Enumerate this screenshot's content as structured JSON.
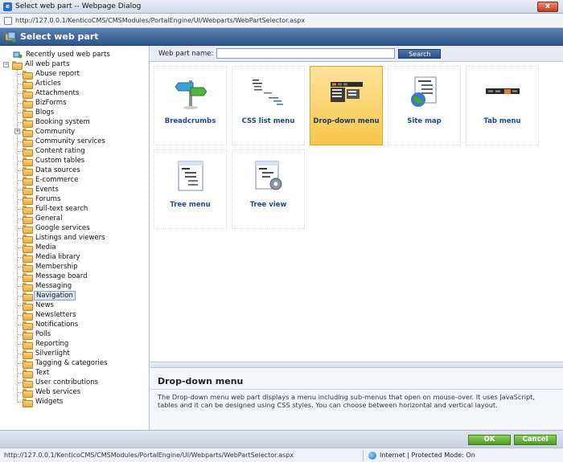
{
  "window": {
    "title": "Select web part -- Webpage Dialog",
    "close_label": "x",
    "url": "http://127.0.0.1/KenticoCMS/CMSModules/PortalEngine/UI/Webparts/WebPartSelector.aspx"
  },
  "header": {
    "title": "Select web part"
  },
  "tree": {
    "recent": "Recently used web parts",
    "root": "All web parts",
    "items": [
      {
        "label": "Abuse report"
      },
      {
        "label": "Articles"
      },
      {
        "label": "Attachments"
      },
      {
        "label": "BizForms"
      },
      {
        "label": "Blogs"
      },
      {
        "label": "Booking system"
      },
      {
        "label": "Community"
      },
      {
        "label": "Community services"
      },
      {
        "label": "Content rating"
      },
      {
        "label": "Custom tables"
      },
      {
        "label": "Data sources"
      },
      {
        "label": "E-commerce"
      },
      {
        "label": "Events"
      },
      {
        "label": "Forums"
      },
      {
        "label": "Full-text search"
      },
      {
        "label": "General"
      },
      {
        "label": "Google services"
      },
      {
        "label": "Listings and viewers"
      },
      {
        "label": "Media"
      },
      {
        "label": "Media library"
      },
      {
        "label": "Membership"
      },
      {
        "label": "Message board"
      },
      {
        "label": "Messaging"
      },
      {
        "label": "Navigation"
      },
      {
        "label": "News"
      },
      {
        "label": "Newsletters"
      },
      {
        "label": "Notifications"
      },
      {
        "label": "Polls"
      },
      {
        "label": "Reporting"
      },
      {
        "label": "Silverlight"
      },
      {
        "label": "Tagging & categories"
      },
      {
        "label": "Text"
      },
      {
        "label": "User contributions"
      },
      {
        "label": "Web services"
      },
      {
        "label": "Widgets"
      }
    ],
    "expandable_item": "Community",
    "selected_item": "Navigation"
  },
  "search": {
    "label": "Web part name:",
    "value": "",
    "button": "Search"
  },
  "webparts": [
    {
      "name": "Breadcrumbs",
      "icon": "signpost-icon"
    },
    {
      "name": "CSS list menu",
      "icon": "css-list-menu-icon"
    },
    {
      "name": "Drop-down menu",
      "icon": "dropdown-menu-icon",
      "selected": true
    },
    {
      "name": "Site map",
      "icon": "site-map-icon"
    },
    {
      "name": "Tab menu",
      "icon": "tab-menu-icon"
    },
    {
      "name": "Tree menu",
      "icon": "tree-menu-icon"
    },
    {
      "name": "Tree view",
      "icon": "tree-view-icon"
    }
  ],
  "description": {
    "title": "Drop-down menu",
    "text": "The Drop-down menu web part displays a menu including sub-menus that open on mouse-over. It uses JavaScript, tables and it can be designed using CSS styles. You can choose between horizontal and vertical layout."
  },
  "footer": {
    "ok": "OK",
    "cancel": "Cancel"
  },
  "status": {
    "url": "http://127.0.0.1/KenticoCMS/CMSModules/PortalEngine/UI/Webparts/WebPartSelector.aspx",
    "zone": "Internet | Protected Mode: On"
  },
  "colors": {
    "accent": "#2f568c",
    "selected_tile": "#f8c64b",
    "ok_button": "#4f9a25"
  }
}
